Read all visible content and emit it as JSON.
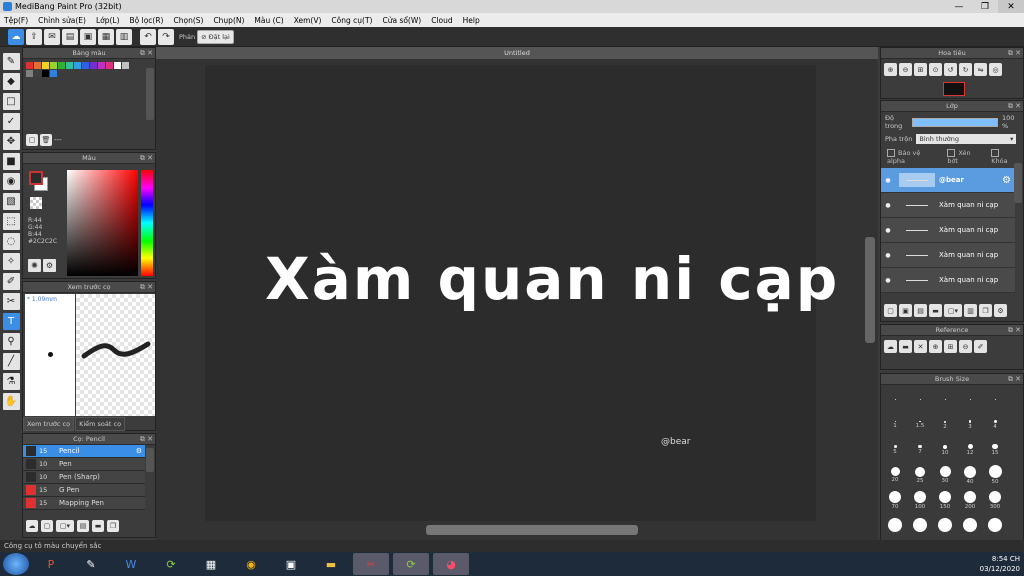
{
  "window": {
    "title": "MediBang Paint Pro (32bit)",
    "bg_tabs": [
      "",
      "",
      "",
      "",
      ""
    ],
    "close": "✕",
    "minimize": "—",
    "maximize": "❐"
  },
  "menu": [
    "Tệp(F)",
    "Chỉnh sửa(E)",
    "Lớp(L)",
    "Bộ lọc(R)",
    "Chọn(S)",
    "Chụp(N)",
    "Màu (C)",
    "Xem(V)",
    "Công cụ(T)",
    "Cửa sổ(W)",
    "Cloud",
    "Help"
  ],
  "toolbar": {
    "label_phan": "Phản",
    "reset": "Đặt lại"
  },
  "panels": {
    "palette": "Bảng màu",
    "palette_dash": "---",
    "color": "Màu",
    "rgb": [
      "R:44",
      "G:44",
      "B:44",
      "#2C2C2C"
    ],
    "brush_preview": "Xem trước cọ",
    "brush_size_text": "* 1.09mm",
    "tab_preview": "Xem trước cọ",
    "tab_control": "Kiểm soát cọ",
    "pencil": "Cọ: Pencil",
    "navigator": "Hoa tiêu",
    "layer": "Lớp",
    "opacity_label": "Độ trong",
    "opacity_value": "100 %",
    "blend_label": "Pha trộn",
    "blend_value": "Bình thường",
    "protect_alpha": "Bảo vệ alpha",
    "clipping": "Xén bớt",
    "lock": "Khóa",
    "reference": "Reference",
    "brush_size": "Brush Size"
  },
  "brushes": [
    {
      "size": "15",
      "name": "Pencil",
      "color": "#2c2c2c",
      "selected": true
    },
    {
      "size": "10",
      "name": "Pen",
      "color": "#2c2c2c"
    },
    {
      "size": "10",
      "name": "Pen (Sharp)",
      "color": "#2c2c2c"
    },
    {
      "size": "15",
      "name": "G Pen",
      "color": "#e03030"
    },
    {
      "size": "15",
      "name": "Mapping Pen",
      "color": "#e03030"
    }
  ],
  "layers": [
    {
      "name": "@bear",
      "selected": true
    },
    {
      "name": "Xàm quan ni cạp"
    },
    {
      "name": "Xàm quan ni cạp"
    },
    {
      "name": "Xàm quan ni cạp"
    },
    {
      "name": "Xàm quan ni cạp"
    }
  ],
  "brush_sizes": [
    "",
    "",
    "",
    "",
    "",
    "1",
    "1.5",
    "2",
    "3",
    "4",
    "5",
    "7",
    "10",
    "12",
    "15",
    "20",
    "25",
    "30",
    "40",
    "50",
    "70",
    "100",
    "150",
    "200",
    "300",
    "",
    "",
    "",
    "",
    ""
  ],
  "canvas": {
    "tab": "Untitled",
    "text": "Xàm quan ni cạp",
    "signature": "@bear"
  },
  "status": "Công cụ tô màu chuyển sắc",
  "tray": {
    "time": "8:54 CH",
    "date": "03/12/2020"
  },
  "palette_colors": [
    "#e03030",
    "#e07030",
    "#f0d020",
    "#9bd030",
    "#30b030",
    "#30c0a0",
    "#30a0e0",
    "#3060e0",
    "#7030d0",
    "#c030c0",
    "#e03080",
    "#ffffff",
    "#c0c0c0",
    "#808080",
    "#404040",
    "#000000",
    "#3080e0"
  ]
}
